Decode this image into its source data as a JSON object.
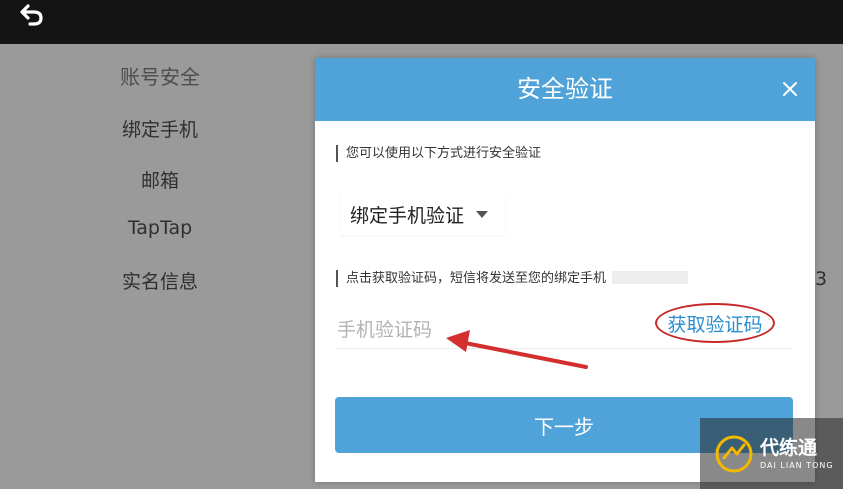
{
  "topbar": {
    "back_icon": "back-arrow-icon"
  },
  "sidebar": {
    "title": "账号安全",
    "items": [
      {
        "label": "绑定手机"
      },
      {
        "label": "邮箱"
      },
      {
        "label": "TapTap"
      },
      {
        "label": "实名信息"
      }
    ]
  },
  "edge_digit": "3",
  "dialog": {
    "title": "安全验证",
    "close_icon": "close-icon",
    "hint_methods": "您可以使用以下方式进行安全验证",
    "method_select": {
      "value": "绑定手机验证"
    },
    "hint_sms": "点击获取验证码，短信将发送至您的绑定手机",
    "code_input": {
      "value": "",
      "placeholder": "手机验证码"
    },
    "get_code_label": "获取验证码",
    "next_label": "下一步"
  },
  "watermark": {
    "name_cn": "代练通",
    "name_en": "DAI LIAN TONG"
  },
  "colors": {
    "accent": "#4fa3d8",
    "link": "#2a8ed1",
    "annotation": "#c62828"
  }
}
